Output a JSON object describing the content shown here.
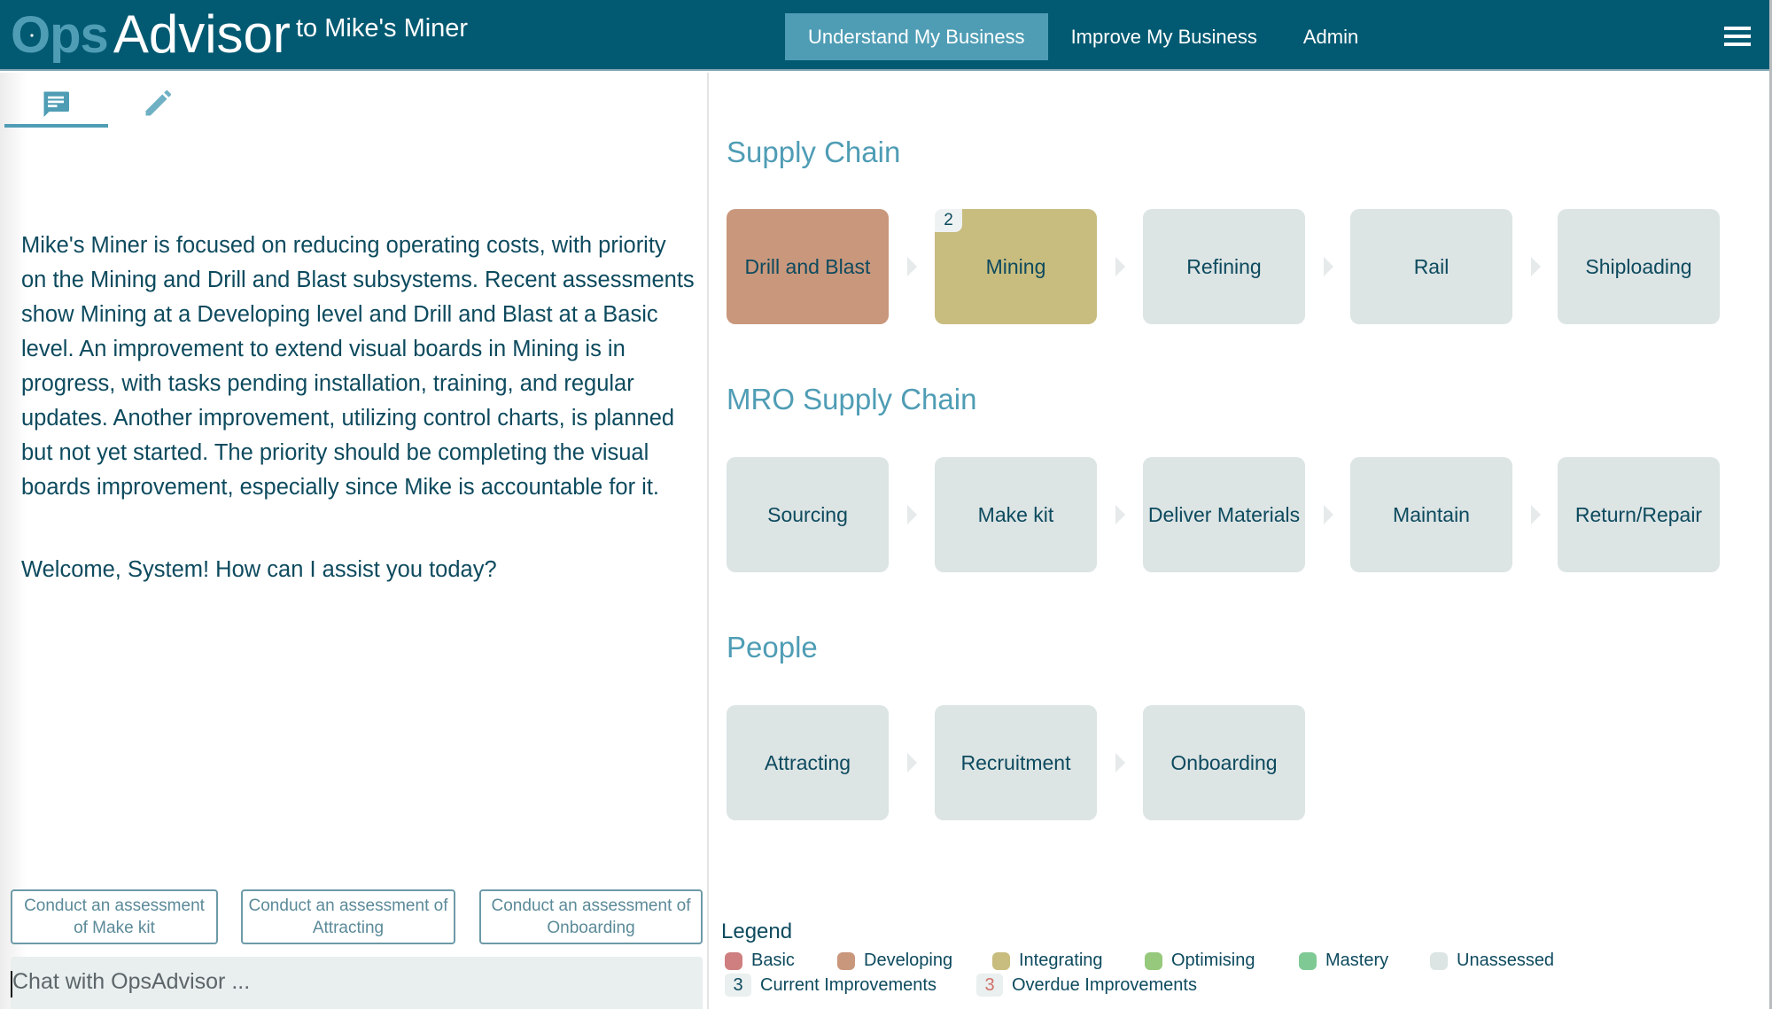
{
  "header": {
    "logo_ops": "Ops",
    "logo_advisor": "Advisor",
    "subtitle": "to Mike's Miner",
    "nav": [
      {
        "label": "Understand My Business",
        "active": true
      },
      {
        "label": "Improve My Business",
        "active": false
      },
      {
        "label": "Admin",
        "active": false
      }
    ],
    "menu_icon": "hamburger-icon"
  },
  "left_panel": {
    "tabs": [
      {
        "icon": "chat-icon",
        "active": true
      },
      {
        "icon": "pencil-icon",
        "active": false
      }
    ],
    "summary": "Mike's Miner is focused on reducing operating costs, with priority on the Mining and Drill and Blast subsystems. Recent assessments show Mining at a Developing level and Drill and Blast at a Basic level. An improvement to extend visual boards in Mining is in progress, with tasks pending installation, training, and regular updates. Another improvement, utilizing control charts, is planned but not yet started. The priority should be completing the visual boards improvement, especially since Mike is accountable for it.",
    "welcome": "Welcome, System! How can I assist you today?",
    "suggestions": [
      "Conduct an assessment of Make kit",
      "Conduct an assessment of Attracting",
      "Conduct an assessment of Onboarding"
    ],
    "chat_placeholder": "Chat with OpsAdvisor ..."
  },
  "colors": {
    "basic": "#cf7f7f",
    "developing": "#c9977c",
    "integrating": "#c8bc7e",
    "optimising": "#96c97c",
    "mastery": "#7fc995",
    "unassessed": "#dce4e4"
  },
  "sections": [
    {
      "title": "Supply Chain",
      "items": [
        {
          "label": "Drill and Blast",
          "level": "developing",
          "badge": null
        },
        {
          "label": "Mining",
          "level": "integrating",
          "badge": "2"
        },
        {
          "label": "Refining",
          "level": "unassessed",
          "badge": null
        },
        {
          "label": "Rail",
          "level": "unassessed",
          "badge": null
        },
        {
          "label": "Shiploading",
          "level": "unassessed",
          "badge": null
        }
      ]
    },
    {
      "title": "MRO Supply Chain",
      "items": [
        {
          "label": "Sourcing",
          "level": "unassessed",
          "badge": null
        },
        {
          "label": "Make kit",
          "level": "unassessed",
          "badge": null
        },
        {
          "label": "Deliver Materials",
          "level": "unassessed",
          "badge": null
        },
        {
          "label": "Maintain",
          "level": "unassessed",
          "badge": null
        },
        {
          "label": "Return/Repair",
          "level": "unassessed",
          "badge": null
        }
      ]
    },
    {
      "title": "People",
      "items": [
        {
          "label": "Attracting",
          "level": "unassessed",
          "badge": null
        },
        {
          "label": "Recruitment",
          "level": "unassessed",
          "badge": null
        },
        {
          "label": "Onboarding",
          "level": "unassessed",
          "badge": null
        }
      ]
    }
  ],
  "legend": {
    "title": "Legend",
    "levels": [
      {
        "label": "Basic",
        "key": "basic"
      },
      {
        "label": "Developing",
        "key": "developing"
      },
      {
        "label": "Integrating",
        "key": "integrating"
      },
      {
        "label": "Optimising",
        "key": "optimising"
      },
      {
        "label": "Mastery",
        "key": "mastery"
      },
      {
        "label": "Unassessed",
        "key": "unassessed"
      }
    ],
    "counts": [
      {
        "value": "3",
        "label": "Current Improvements",
        "color": "#0d4a5e"
      },
      {
        "value": "3",
        "label": "Overdue Improvements",
        "color": "#d0706a"
      }
    ]
  }
}
